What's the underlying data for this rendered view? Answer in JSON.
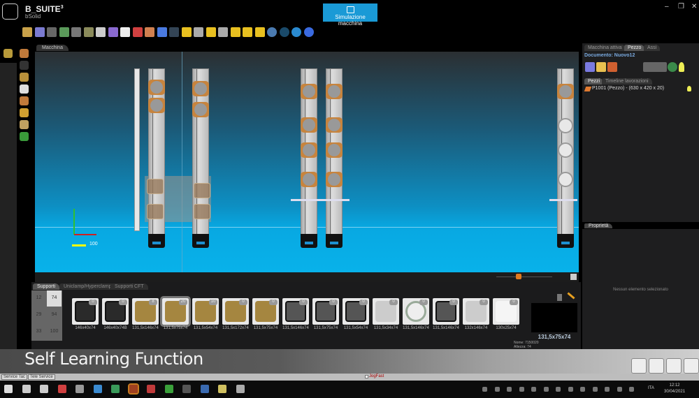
{
  "app": {
    "title": "B_SUITE",
    "title_sup": "3",
    "subtitle": "bSolid",
    "sim_button": "Simulazione macchina",
    "win_min": "–",
    "win_max": "❐",
    "win_close": "✕"
  },
  "toolbar": {
    "icons": [
      "open-folder",
      "save",
      "new-doc",
      "refresh-doc",
      "copy",
      "paste",
      "move-origin",
      "axis-rotate",
      "pan-hand",
      "zoom-fit",
      "eraser",
      "undo",
      "redo",
      "view-iso",
      "view-front",
      "view-left",
      "view-right",
      "view-top",
      "view-back",
      "view-shaded",
      "view-globe",
      "sphere-dark",
      "sphere-light",
      "help"
    ]
  },
  "viewport": {
    "tab": "Macchina",
    "axis_label": "100"
  },
  "right_panel": {
    "tabs": [
      "Macchina attiva",
      "Pezzo",
      "Assi"
    ],
    "active_tab": "Pezzo",
    "document_label": "Documento: Nuovo12",
    "sub_tabs": [
      "Pezzi",
      "Timeline lavorazioni"
    ],
    "piece_item": "P1001 (Pezzo) - (630 x 420 x 20)",
    "properties_tab": "Proprietà",
    "properties_empty": "Nessun elemento selezionato"
  },
  "supports": {
    "tabs": [
      "Supporti",
      "Uniclamp/Hyperclamp",
      "Supporti CFT"
    ],
    "grid": [
      "12",
      "74",
      "29",
      "94",
      "33",
      "100"
    ],
    "items": [
      {
        "label": "146x40x74",
        "count": "0",
        "kind": "dark"
      },
      {
        "label": "146x40x74B",
        "count": "0",
        "kind": "dark"
      },
      {
        "label": "131,5x146x74",
        "count": "8",
        "kind": "brown"
      },
      {
        "label": "131,5x75x74",
        "count": "20",
        "kind": "brown"
      },
      {
        "label": "131,5x54x74",
        "count": "10",
        "kind": "brown"
      },
      {
        "label": "131,5x172x74",
        "count": "0",
        "kind": "brown"
      },
      {
        "label": "131,5x75x74",
        "count": "0",
        "kind": "brown"
      },
      {
        "label": "131,5x146x74",
        "count": "0",
        "kind": "gray"
      },
      {
        "label": "131,5x75x74",
        "count": "0",
        "kind": "gray"
      },
      {
        "label": "131,5x54x74",
        "count": "0",
        "kind": "gray"
      },
      {
        "label": "131,5x34x74",
        "count": "0",
        "kind": "light"
      },
      {
        "label": "131,5x146x74",
        "count": "0",
        "kind": "ring"
      },
      {
        "label": "131,5x146x74",
        "count": "0",
        "kind": "gray"
      },
      {
        "label": "132x146x74",
        "count": "0",
        "kind": "double"
      },
      {
        "label": "130x25x74",
        "count": "0",
        "kind": "white"
      }
    ],
    "preview_label": "131,5x75x74",
    "preview_name": "Nome: 7150020",
    "preview_height": "Altezza: 74"
  },
  "overlay": {
    "caption": "Self Learning Function"
  },
  "statusbar": {
    "service_tac": "Service Tac",
    "tele_service": "Tele Service",
    "jogfast": "JogFast"
  },
  "taskbar": {
    "lang": "ITA",
    "time": "12:12",
    "date": "30/04/2021"
  },
  "colors": {
    "accent": "#1a9ad6",
    "orange": "#c7843e"
  }
}
